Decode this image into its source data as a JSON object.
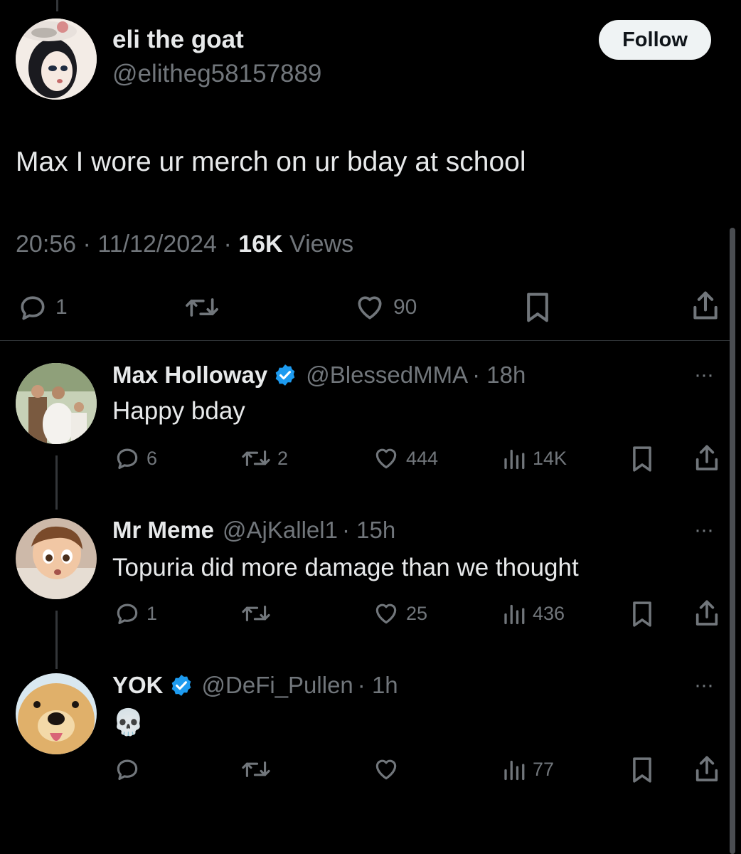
{
  "main_tweet": {
    "display_name": "eli the goat",
    "handle": "@elitheg58157889",
    "follow_label": "Follow",
    "text": "Max I wore ur merch on ur bday at school",
    "time": "20:56",
    "date": "11/12/2024",
    "views_count": "16K",
    "views_label": "Views",
    "replies": "1",
    "likes": "90",
    "sep": "·"
  },
  "replies": [
    {
      "display_name": "Max Holloway",
      "verified": true,
      "handle": "@BlessedMMA",
      "age": "· 18h",
      "text": "Happy bday",
      "replies": "6",
      "reposts": "2",
      "likes": "444",
      "views": "14K",
      "more": "···"
    },
    {
      "display_name": "Mr Meme",
      "verified": false,
      "handle": "@AjKallel1",
      "age": "· 15h",
      "text": "Topuria did more damage than we thought",
      "replies": "1",
      "reposts": "",
      "likes": "25",
      "views": "436",
      "more": "···"
    },
    {
      "display_name": "YOK",
      "verified": true,
      "handle": "@DeFi_Pullen",
      "age": "· 1h",
      "text": "💀",
      "replies": "",
      "reposts": "",
      "likes": "",
      "views": "77",
      "more": "···"
    }
  ],
  "colors": {
    "background": "#000000",
    "primary_text": "#e7e9ea",
    "secondary_text": "#71767b",
    "verified_blue": "#1d9bf0",
    "follow_bg": "#eff3f4"
  }
}
